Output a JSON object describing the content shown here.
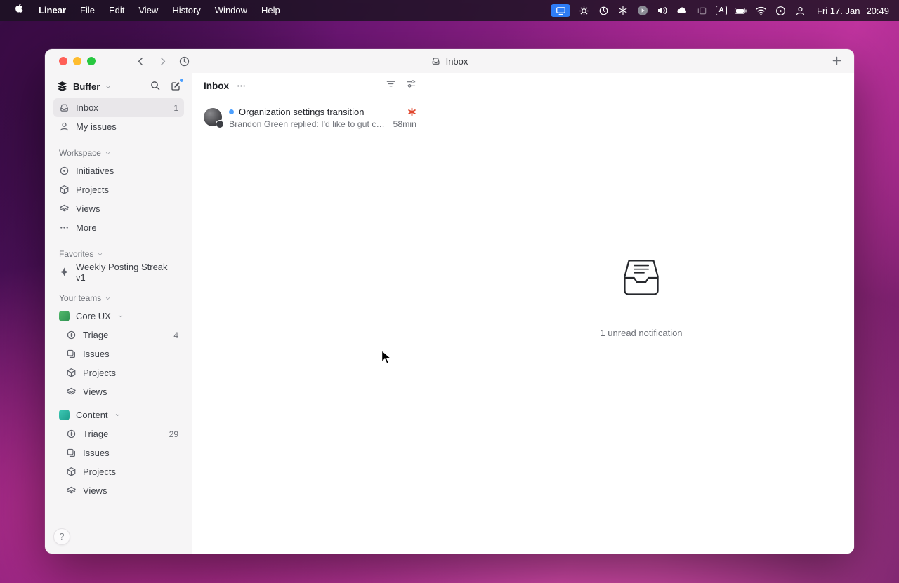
{
  "menubar": {
    "app_name": "Linear",
    "menus": [
      "File",
      "Edit",
      "View",
      "History",
      "Window",
      "Help"
    ],
    "clock_date": "Fri 17. Jan",
    "clock_time": "20:49"
  },
  "titlebar": {
    "title": "Inbox"
  },
  "sidebar": {
    "workspace_name": "Buffer",
    "nav": [
      {
        "label": "Inbox",
        "badge": "1"
      },
      {
        "label": "My issues"
      }
    ],
    "workspace_section": {
      "label": "Workspace",
      "items": [
        "Initiatives",
        "Projects",
        "Views",
        "More"
      ]
    },
    "favorites_section": {
      "label": "Favorites",
      "items": [
        "Weekly Posting Streak v1"
      ]
    },
    "teams_section": {
      "label": "Your teams",
      "teams": [
        {
          "name": "Core UX",
          "color": "#3fa45f",
          "items": [
            {
              "label": "Triage",
              "badge": "4"
            },
            {
              "label": "Issues"
            },
            {
              "label": "Projects"
            },
            {
              "label": "Views"
            }
          ]
        },
        {
          "name": "Content",
          "color": "#2fb6a5",
          "items": [
            {
              "label": "Triage",
              "badge": "29"
            },
            {
              "label": "Issues"
            },
            {
              "label": "Projects"
            },
            {
              "label": "Views"
            }
          ]
        }
      ]
    },
    "help_label": "?"
  },
  "list": {
    "title": "Inbox",
    "notification": {
      "title": "Organization settings transition",
      "preview": "Brandon Green replied: I'd like to gut check wi...",
      "time": "58min"
    }
  },
  "empty_state": {
    "caption": "1 unread notification"
  },
  "colors": {
    "unread_dot": "#4c9ffe",
    "flower_icon": "#e0452c",
    "menubar_indicator": "#2e7cf6"
  }
}
